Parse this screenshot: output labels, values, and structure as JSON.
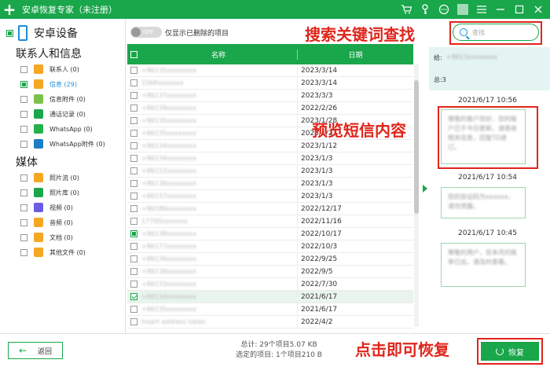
{
  "titlebar": {
    "logo": "+",
    "title": "安卓恢复专家（未注册）",
    "icons": [
      "cart-icon",
      "key-icon",
      "chat-icon",
      "menu-icon",
      "minimize-icon",
      "maximize-icon",
      "close-icon"
    ]
  },
  "sidebar": {
    "device_name": "安卓设备",
    "section1": "联系人和信息",
    "section2": "媒体",
    "items1": [
      {
        "label": "联系人 (0)",
        "icon": "contacts-icon",
        "color": "#f5a623"
      },
      {
        "label": "信息 (29)",
        "icon": "messages-icon",
        "color": "#f5a623"
      },
      {
        "label": "信息附件 (0)",
        "icon": "attachment-icon",
        "color": "#7cc24a"
      },
      {
        "label": "通话记录 (0)",
        "icon": "call-log-icon",
        "color": "#1aa64b"
      },
      {
        "label": "WhatsApp (0)",
        "icon": "whatsapp-icon",
        "color": "#25b04b"
      },
      {
        "label": "WhatsApp附件 (0)",
        "icon": "whatsapp-attachment-icon",
        "color": "#1a7fc6"
      }
    ],
    "items2": [
      {
        "label": "照片流 (0)",
        "icon": "photo-stream-icon",
        "color": "#f5a623"
      },
      {
        "label": "照片库 (0)",
        "icon": "photo-library-icon",
        "color": "#1aa64b"
      },
      {
        "label": "视频 (0)",
        "icon": "video-icon",
        "color": "#6b5ce6"
      },
      {
        "label": "音频 (0)",
        "icon": "audio-icon",
        "color": "#f5a623"
      },
      {
        "label": "文档 (0)",
        "icon": "document-icon",
        "color": "#f5a623"
      },
      {
        "label": "其他文件 (0)",
        "icon": "other-files-icon",
        "color": "#f5a623"
      }
    ]
  },
  "toolbar": {
    "toggle_text": "OFF",
    "toggle_label": "仅显示已删除的项目"
  },
  "table": {
    "col_name": "名称",
    "col_date": "日期",
    "rows": [
      {
        "name": "+86135xxxxxxxx",
        "date": "2023/3/14"
      },
      {
        "name": "1568xxxxxxx",
        "date": "2023/3/14"
      },
      {
        "name": "+86137xxxxxxxx",
        "date": "2023/3/3"
      },
      {
        "name": "+86139xxxxxxxx",
        "date": "2022/2/26"
      },
      {
        "name": "+86135xxxxxxxx",
        "date": "2023/1/28"
      },
      {
        "name": "+86135xxxxxxxx",
        "date": "2023/1/27"
      },
      {
        "name": "+86134xxxxxxxx",
        "date": "2023/1/12"
      },
      {
        "name": "+86134xxxxxxxx",
        "date": "2023/1/3"
      },
      {
        "name": "+86152xxxxxxxx",
        "date": "2023/1/3"
      },
      {
        "name": "+86136xxxxxxxx",
        "date": "2023/1/3"
      },
      {
        "name": "+86157xxxxxxxx",
        "date": "2023/1/3"
      },
      {
        "name": "+86186xxxxxxxx",
        "date": "2022/12/17"
      },
      {
        "name": "17790xxxxxxx",
        "date": "2022/11/16"
      },
      {
        "name": "+86138xxxxxxxx",
        "date": "2022/10/17"
      },
      {
        "name": "+86177xxxxxxxx",
        "date": "2022/10/3"
      },
      {
        "name": "+86136xxxxxxxx",
        "date": "2022/9/25"
      },
      {
        "name": "+86139xxxxxxxx",
        "date": "2022/9/5"
      },
      {
        "name": "+86133xxxxxxxx",
        "date": "2022/7/30"
      },
      {
        "name": "+86134xxxxxxxx",
        "date": "2021/6/17"
      },
      {
        "name": "+86135xxxxxxxx",
        "date": "2021/6/17"
      },
      {
        "name": "Insert address token",
        "date": "2022/4/2"
      }
    ]
  },
  "search": {
    "placeholder": "查找"
  },
  "info": {
    "to_label": "给:",
    "to_value": "+8613xxxxxxxx",
    "total": "总:3"
  },
  "messages": [
    {
      "time": "2021/6/17 10:56",
      "text": "尊敬的客户您好，您的账户已于今日更新，请查收相关信息，回复TD退订。"
    },
    {
      "time": "2021/6/17 10:54",
      "text": "您的验证码为xxxxxx，请勿泄露。"
    },
    {
      "time": "2021/6/17 10:45",
      "text": "尊敬的用户，您本月的账单已出，请及时查看。"
    }
  ],
  "annotations": {
    "search": "搜索关键词查找",
    "preview": "预览短信内容",
    "recover": "点击即可恢复"
  },
  "bottom": {
    "back": "返回",
    "total": "总计: 29个项目5.07 KB",
    "selected": "选定的项目: 1个项目210 B",
    "recover": "恢复"
  },
  "colors": {
    "brand": "#1aa64b",
    "annotation": "#e0251b"
  }
}
